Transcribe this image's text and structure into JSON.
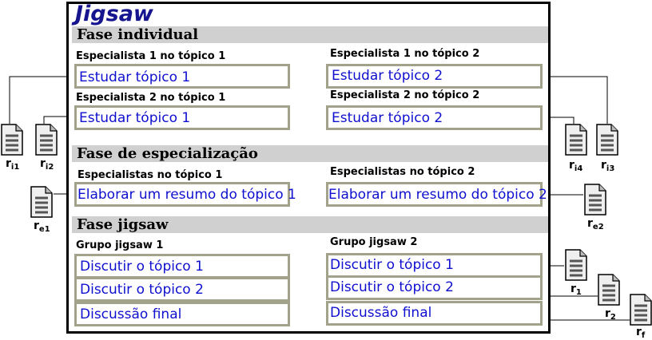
{
  "title": "Jigsaw",
  "phases": {
    "individual": {
      "label": "Fase individual",
      "left_top_caption": "Especialista 1 no tópico 1",
      "left_top_task": "Estudar tópico 1",
      "left_bottom_caption": "Especialista 2 no tópico 1",
      "left_bottom_task": "Estudar tópico 1",
      "right_top_caption": "Especialista 1 no tópico 2",
      "right_top_task": "Estudar tópico 2",
      "right_bottom_caption": "Especialista 2 no tópico 2",
      "right_bottom_task": "Estudar tópico 2"
    },
    "specialization": {
      "label": "Fase de especialização",
      "left_caption": "Especialistas no tópico 1",
      "left_task": "Elaborar um resumo do tópico 1",
      "right_caption": "Especialistas no tópico 2",
      "right_task": "Elaborar um resumo do tópico 2"
    },
    "jigsaw": {
      "label": "Fase jigsaw",
      "group1_caption": "Grupo jigsaw 1",
      "group1_tasks": [
        "Discutir o tópico 1",
        "Discutir o tópico 2",
        "Discussão final"
      ],
      "group2_caption": "Grupo jigsaw 2",
      "group2_tasks": [
        "Discutir o tópico 1",
        "Discutir o tópico 2",
        "Discussão final"
      ]
    }
  },
  "results": {
    "ri1": {
      "base": "r",
      "sub": "i1"
    },
    "ri2": {
      "base": "r",
      "sub": "i2"
    },
    "ri3": {
      "base": "r",
      "sub": "i3"
    },
    "ri4": {
      "base": "r",
      "sub": "i4"
    },
    "re1": {
      "base": "r",
      "sub": "e1"
    },
    "re2": {
      "base": "r",
      "sub": "e2"
    },
    "r1": {
      "base": "r",
      "sub": "1"
    },
    "r2": {
      "base": "r",
      "sub": "2"
    },
    "rf": {
      "base": "r",
      "sub": "f"
    }
  },
  "colors": {
    "title": "#16158f",
    "task_text": "#0f0fcf",
    "box_border": "#a3a38b",
    "phase_band": "#d0d0d0",
    "frame": "#000000"
  },
  "icons": {
    "result": "document-icon"
  }
}
